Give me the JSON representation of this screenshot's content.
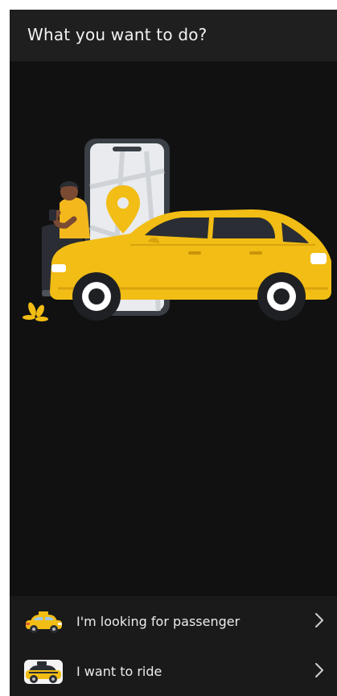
{
  "app_bar": {
    "title": "What you want to do?"
  },
  "hero": {
    "illustration": "man-leaning-on-yellow-car-with-phone-map-pin",
    "colors": {
      "car": "#f2bd14",
      "shirt": "#f5b81c",
      "phone_frame": "#3a3f45",
      "map_pin": "#f2bd14"
    }
  },
  "options": [
    {
      "label": "I'm looking for passenger",
      "icon": "yellow-taxi-icon",
      "chevron": "chevron-right-icon"
    },
    {
      "label": "I want to ride",
      "icon": "taxi-passenger-icon",
      "chevron": "chevron-right-icon"
    }
  ],
  "theme": {
    "background": "#111111",
    "app_bar_background": "#1f1f1f",
    "options_background": "#1a1a1a",
    "text": "#ececec"
  }
}
